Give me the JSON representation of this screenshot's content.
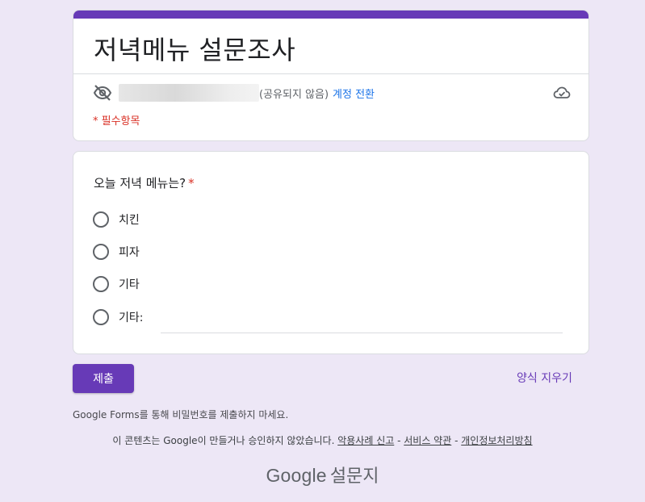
{
  "header": {
    "title": "저녁메뉴 설문조사",
    "not_shared": "(공유되지 않음)",
    "switch_account": "계정 전환",
    "required_note": "* 필수항목",
    "accent_color": "#673ab7",
    "icons": [
      "eye-off-icon",
      "cloud-saved-icon"
    ]
  },
  "question": {
    "title": "오늘 저녁 메뉴는?",
    "required_mark": "*",
    "options": [
      {
        "label": "치킨"
      },
      {
        "label": "피자"
      },
      {
        "label": "기타"
      },
      {
        "label": "기타:"
      }
    ],
    "other_value": ""
  },
  "actions": {
    "submit_label": "제출",
    "clear_label": "양식 지우기"
  },
  "footer": {
    "password_note": "Google Forms를 통해 비밀번호를 제출하지 마세요.",
    "disclaimer": "이 콘텐츠는 Google이 만들거나 승인하지 않았습니다.",
    "report_abuse": "악용사례 신고",
    "sep1": " - ",
    "terms": "서비스 약관",
    "sep2": " - ",
    "privacy": "개인정보처리방침",
    "brand_google": "Google",
    "brand_forms": "설문지"
  }
}
